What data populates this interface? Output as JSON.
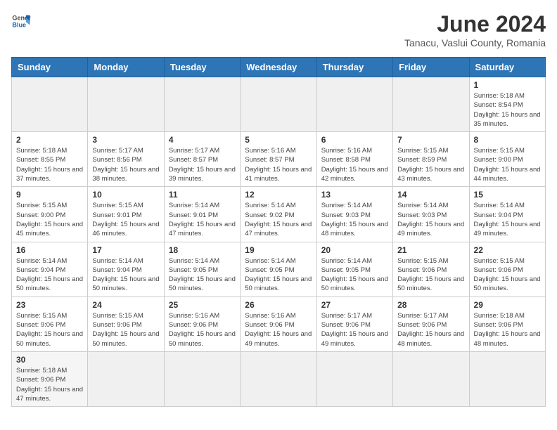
{
  "header": {
    "logo_general": "General",
    "logo_blue": "Blue",
    "month_year": "June 2024",
    "location": "Tanacu, Vaslui County, Romania"
  },
  "weekdays": [
    "Sunday",
    "Monday",
    "Tuesday",
    "Wednesday",
    "Thursday",
    "Friday",
    "Saturday"
  ],
  "weeks": [
    [
      {
        "day": "",
        "info": ""
      },
      {
        "day": "",
        "info": ""
      },
      {
        "day": "",
        "info": ""
      },
      {
        "day": "",
        "info": ""
      },
      {
        "day": "",
        "info": ""
      },
      {
        "day": "",
        "info": ""
      },
      {
        "day": "1",
        "info": "Sunrise: 5:18 AM\nSunset: 8:54 PM\nDaylight: 15 hours and 35 minutes."
      }
    ],
    [
      {
        "day": "2",
        "info": "Sunrise: 5:18 AM\nSunset: 8:55 PM\nDaylight: 15 hours and 37 minutes."
      },
      {
        "day": "3",
        "info": "Sunrise: 5:17 AM\nSunset: 8:56 PM\nDaylight: 15 hours and 38 minutes."
      },
      {
        "day": "4",
        "info": "Sunrise: 5:17 AM\nSunset: 8:57 PM\nDaylight: 15 hours and 39 minutes."
      },
      {
        "day": "5",
        "info": "Sunrise: 5:16 AM\nSunset: 8:57 PM\nDaylight: 15 hours and 41 minutes."
      },
      {
        "day": "6",
        "info": "Sunrise: 5:16 AM\nSunset: 8:58 PM\nDaylight: 15 hours and 42 minutes."
      },
      {
        "day": "7",
        "info": "Sunrise: 5:15 AM\nSunset: 8:59 PM\nDaylight: 15 hours and 43 minutes."
      },
      {
        "day": "8",
        "info": "Sunrise: 5:15 AM\nSunset: 9:00 PM\nDaylight: 15 hours and 44 minutes."
      }
    ],
    [
      {
        "day": "9",
        "info": "Sunrise: 5:15 AM\nSunset: 9:00 PM\nDaylight: 15 hours and 45 minutes."
      },
      {
        "day": "10",
        "info": "Sunrise: 5:15 AM\nSunset: 9:01 PM\nDaylight: 15 hours and 46 minutes."
      },
      {
        "day": "11",
        "info": "Sunrise: 5:14 AM\nSunset: 9:01 PM\nDaylight: 15 hours and 47 minutes."
      },
      {
        "day": "12",
        "info": "Sunrise: 5:14 AM\nSunset: 9:02 PM\nDaylight: 15 hours and 47 minutes."
      },
      {
        "day": "13",
        "info": "Sunrise: 5:14 AM\nSunset: 9:03 PM\nDaylight: 15 hours and 48 minutes."
      },
      {
        "day": "14",
        "info": "Sunrise: 5:14 AM\nSunset: 9:03 PM\nDaylight: 15 hours and 49 minutes."
      },
      {
        "day": "15",
        "info": "Sunrise: 5:14 AM\nSunset: 9:04 PM\nDaylight: 15 hours and 49 minutes."
      }
    ],
    [
      {
        "day": "16",
        "info": "Sunrise: 5:14 AM\nSunset: 9:04 PM\nDaylight: 15 hours and 50 minutes."
      },
      {
        "day": "17",
        "info": "Sunrise: 5:14 AM\nSunset: 9:04 PM\nDaylight: 15 hours and 50 minutes."
      },
      {
        "day": "18",
        "info": "Sunrise: 5:14 AM\nSunset: 9:05 PM\nDaylight: 15 hours and 50 minutes."
      },
      {
        "day": "19",
        "info": "Sunrise: 5:14 AM\nSunset: 9:05 PM\nDaylight: 15 hours and 50 minutes."
      },
      {
        "day": "20",
        "info": "Sunrise: 5:14 AM\nSunset: 9:05 PM\nDaylight: 15 hours and 50 minutes."
      },
      {
        "day": "21",
        "info": "Sunrise: 5:15 AM\nSunset: 9:06 PM\nDaylight: 15 hours and 50 minutes."
      },
      {
        "day": "22",
        "info": "Sunrise: 5:15 AM\nSunset: 9:06 PM\nDaylight: 15 hours and 50 minutes."
      }
    ],
    [
      {
        "day": "23",
        "info": "Sunrise: 5:15 AM\nSunset: 9:06 PM\nDaylight: 15 hours and 50 minutes."
      },
      {
        "day": "24",
        "info": "Sunrise: 5:15 AM\nSunset: 9:06 PM\nDaylight: 15 hours and 50 minutes."
      },
      {
        "day": "25",
        "info": "Sunrise: 5:16 AM\nSunset: 9:06 PM\nDaylight: 15 hours and 50 minutes."
      },
      {
        "day": "26",
        "info": "Sunrise: 5:16 AM\nSunset: 9:06 PM\nDaylight: 15 hours and 49 minutes."
      },
      {
        "day": "27",
        "info": "Sunrise: 5:17 AM\nSunset: 9:06 PM\nDaylight: 15 hours and 49 minutes."
      },
      {
        "day": "28",
        "info": "Sunrise: 5:17 AM\nSunset: 9:06 PM\nDaylight: 15 hours and 48 minutes."
      },
      {
        "day": "29",
        "info": "Sunrise: 5:18 AM\nSunset: 9:06 PM\nDaylight: 15 hours and 48 minutes."
      }
    ],
    [
      {
        "day": "30",
        "info": "Sunrise: 5:18 AM\nSunset: 9:06 PM\nDaylight: 15 hours and 47 minutes."
      },
      {
        "day": "",
        "info": ""
      },
      {
        "day": "",
        "info": ""
      },
      {
        "day": "",
        "info": ""
      },
      {
        "day": "",
        "info": ""
      },
      {
        "day": "",
        "info": ""
      },
      {
        "day": "",
        "info": ""
      }
    ]
  ]
}
